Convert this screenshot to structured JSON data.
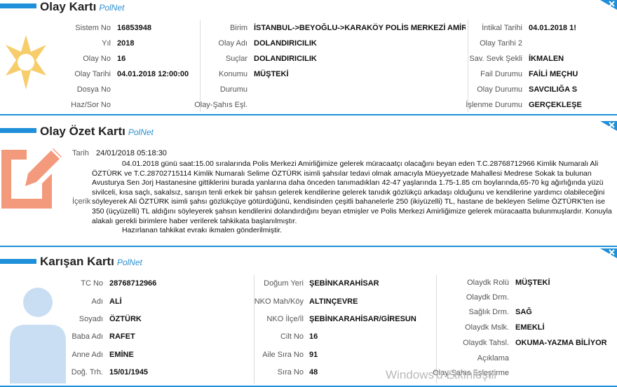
{
  "olay_karti": {
    "title": "Olay Kartı",
    "brand": "PolNet",
    "col1": [
      {
        "label": "Sistem No",
        "value": "16853948"
      },
      {
        "label": "Yıl",
        "value": "2018"
      },
      {
        "label": "Olay No",
        "value": "16"
      },
      {
        "label": "Olay Tarihi",
        "value": "04.01.2018 12:00:00"
      },
      {
        "label": "Dosya No",
        "value": ""
      },
      {
        "label": "Haz/Sor No",
        "value": ""
      }
    ],
    "col2": [
      {
        "label": "Birim",
        "value": "İSTANBUL->BEYOĞLU->KARAKÖY POLİS MERKEZİ AMİRLİĞİ"
      },
      {
        "label": "Olay Adı",
        "value": "DOLANDIRICILIK"
      },
      {
        "label": "Suçlar",
        "value": "DOLANDIRICILIK"
      },
      {
        "label": "Konumu",
        "value": "MÜŞTEKİ"
      },
      {
        "label": "Durumu",
        "value": ""
      },
      {
        "label": "Olay-Şahıs Eşl.",
        "value": ""
      }
    ],
    "col3": [
      {
        "label": "İntikal Tarihi",
        "value": "04.01.2018 1!"
      },
      {
        "label": "Olay Tarihi 2",
        "value": ""
      },
      {
        "label": "Sav. Sevk Şekli",
        "value": "İKMALEN"
      },
      {
        "label": "Fail Durumu",
        "value": "FAİLİ MEÇHU"
      },
      {
        "label": "Olay Durumu",
        "value": "SAVCILIĞA S"
      },
      {
        "label": "İşlenme Durumu",
        "value": "GERÇEKLEŞE"
      }
    ]
  },
  "olay_ozet": {
    "title": "Olay Özet Kartı",
    "brand": "PolNet",
    "tarih_label": "Tarih",
    "tarih_value": "24/01/2018 05:18:30",
    "icerik_label": "İçerik",
    "paragraph1": "04.01.2018 günü saat:15.00 sıralarında Polis Merkezi Amirliğimize gelerek müracaatçı olacağını beyan eden T.C.28768712966 Kimlik Numaralı Ali ÖZTÜRK ve T.C.28702715114 Kimlik Numaralı Selime ÖZTÜRK isimli şahsılar tedavi olmak amacıyla Müeyyetzade Mahallesi Medrese Sokak ta bulunan Avusturya Sen Jorj Hastanesine gittiklerini burada yanlarına daha önceden tanımadıkları 42-47 yaşlarında 1.75-1.85 cm boylarında,65-70 kg ağırlığında yüzü sivilceli, kısa saçlı, sakalsız, sarışın tenli erkek bir şahsın gelerek kendilerine gelerek tanıdık gözlükçü arkadaşı olduğunu ve kendilerine yardımcı olabileceğini söyleyerek Ali ÖZTÜRK isimli şahsı gözlükçüye götürdüğünü, kendisinden çeşitli bahanelerle 250 (ikiyüzelli) TL, hastane de bekleyen Selime ÖZTÜRK'ten ise 350 (üçyüzelli) TL aldığını söyleyerek şahsın kendilerini dolandırdığını beyan etmişler ve Polis Merkezi Amirliğimize gelerek müracaatta bulunmuşlardır. Konuyla alakalı gerekli birimlere haber verilerek tahkikata başlanılmıştır.",
    "paragraph2": "Hazırlanan tahkikat evrakı ikmalen gönderilmiştir."
  },
  "karisan": {
    "title": "Karışan Kartı",
    "brand": "PolNet",
    "col1": [
      {
        "label": "TC No",
        "value": "28768712966"
      },
      {
        "label": "Adı",
        "value": "ALİ"
      },
      {
        "label": "Soyadı",
        "value": "ÖZTÜRK"
      },
      {
        "label": "Baba Adı",
        "value": "RAFET"
      },
      {
        "label": "Anne Adı",
        "value": "EMİNE"
      },
      {
        "label": "Doğ. Trh.",
        "value": "15/01/1945"
      }
    ],
    "col2": [
      {
        "label": "Doğum Yeri",
        "value": "ŞEBİNKARAHİSAR"
      },
      {
        "label": "NKO Mah/Köy",
        "value": "ALTINÇEVRE"
      },
      {
        "label": "NKO İlçe/İl",
        "value": "ŞEBİNKARAHİSAR/GİRESUN"
      },
      {
        "label": "Cilt No",
        "value": "16"
      },
      {
        "label": "Aile Sıra No",
        "value": "91"
      },
      {
        "label": "Sıra No",
        "value": "48"
      }
    ],
    "col3": [
      {
        "label": "Olaydk Rolü",
        "value": "MÜŞTEKİ"
      },
      {
        "label": "Olaydk Drm.",
        "value": ""
      },
      {
        "label": "Sağlık Drm.",
        "value": "SAĞ"
      },
      {
        "label": "Olaydk Mslk.",
        "value": "EMEKLİ"
      },
      {
        "label": "Olaydk Tahsl.",
        "value": "OKUMA-YAZMA BİLİYOR"
      },
      {
        "label": "Açıklama",
        "value": ""
      },
      {
        "label": "Olay-Şahıs Eşleştirme",
        "value": ""
      }
    ]
  },
  "watermark": "Windows'u Etkinleştir",
  "colors": {
    "accent": "#1e8fd8",
    "icon_star": "#f6cd6a",
    "icon_doc": "#f39a7c",
    "icon_person": "#c9def3"
  }
}
